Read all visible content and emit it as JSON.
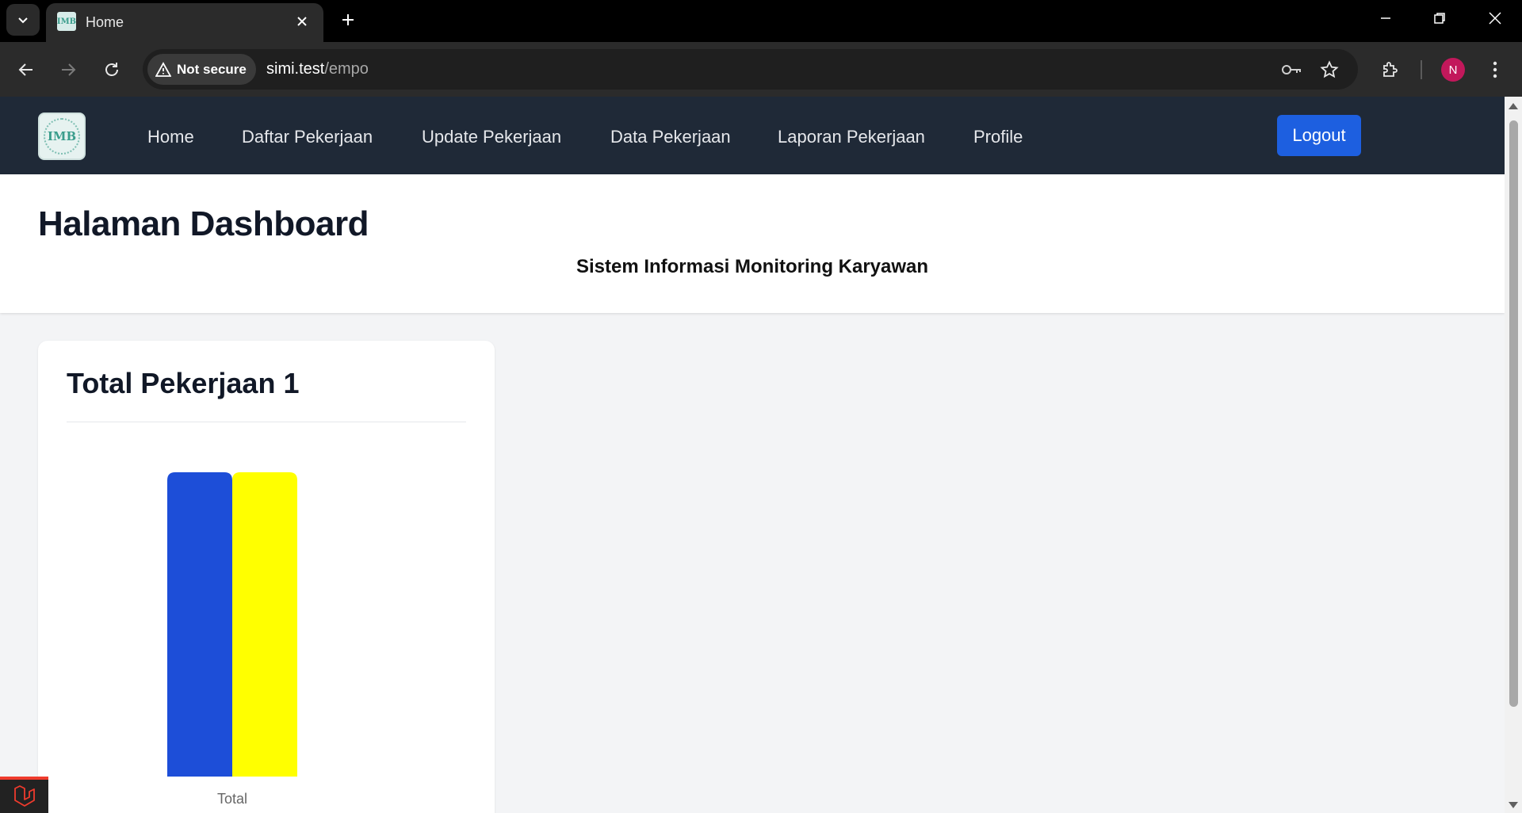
{
  "browser": {
    "tab_title": "Home",
    "favicon_text": "IMB",
    "security_label": "Not secure",
    "url_host": "simi.test",
    "url_path": "/empo",
    "profile_initial": "N"
  },
  "nav": {
    "logo_text": "IMB",
    "links": [
      "Home",
      "Daftar Pekerjaan",
      "Update Pekerjaan",
      "Data Pekerjaan",
      "Laporan Pekerjaan",
      "Profile"
    ],
    "logout_label": "Logout"
  },
  "header": {
    "title": "Halaman Dashboard",
    "subtitle": "Sistem Informasi Monitoring Karyawan"
  },
  "card": {
    "title": "Total Pekerjaan 1"
  },
  "chart_data": {
    "type": "bar",
    "categories": [
      "Total"
    ],
    "series": [
      {
        "values": [
          1
        ],
        "color": "#1d4ed8"
      },
      {
        "values": [
          1
        ],
        "color": "#ffff00"
      }
    ],
    "ylim": [
      0,
      1
    ],
    "grid": false
  },
  "colors": {
    "nav_bg": "#1f2937",
    "logout_bg": "#1d5fe0"
  }
}
